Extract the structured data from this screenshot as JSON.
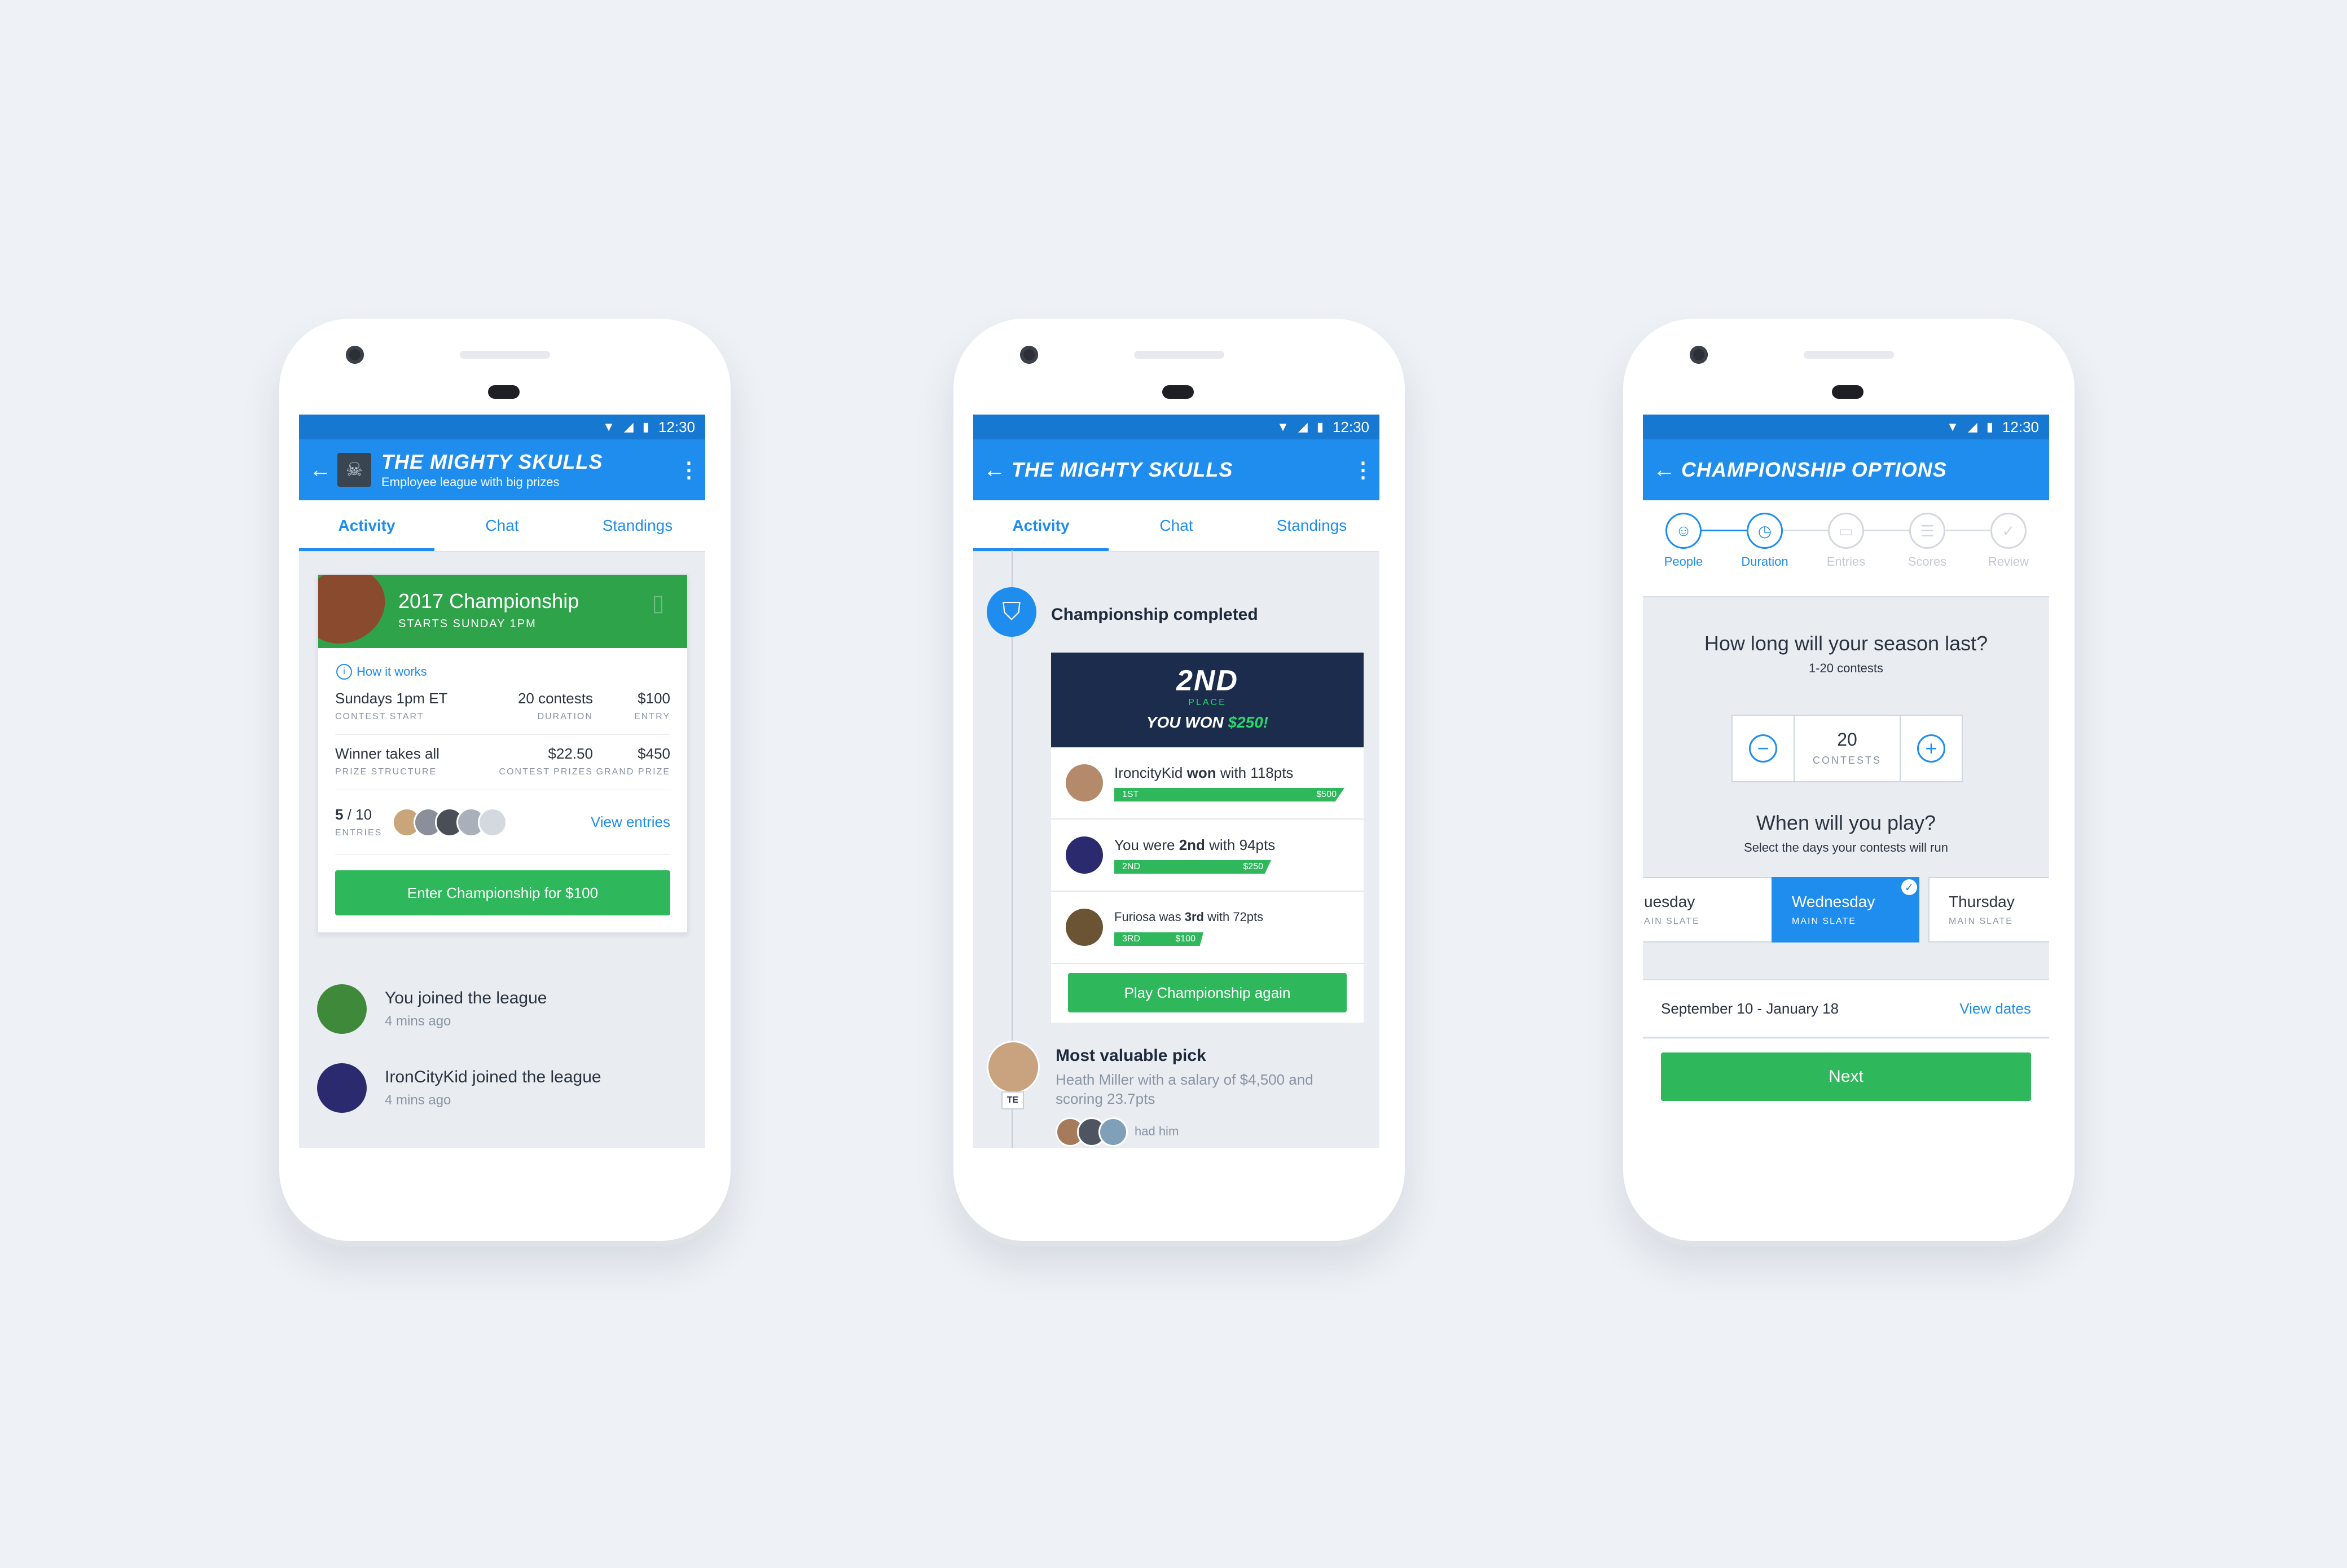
{
  "status": {
    "time": "12:30"
  },
  "screen1": {
    "title": "THE MIGHTY SKULLS",
    "subtitle": "Employee league with big prizes",
    "tabs": [
      "Activity",
      "Chat",
      "Standings"
    ],
    "card": {
      "title": "2017 Championship",
      "subtitle": "STARTS SUNDAY 1PM",
      "how": "How it works",
      "row1": [
        {
          "value": "Sundays 1pm ET",
          "label": "CONTEST START"
        },
        {
          "value": "20 contests",
          "label": "DURATION"
        },
        {
          "value": "$100",
          "label": "ENTRY"
        }
      ],
      "row2": [
        {
          "value": "Winner takes all",
          "label": "PRIZE STRUCTURE"
        },
        {
          "value": "$22.50",
          "label": "CONTEST PRIZES"
        },
        {
          "value": "$450",
          "label": "GRAND PRIZE"
        }
      ],
      "entries_count": "5",
      "entries_total": " / 10",
      "entries_label": "ENTRIES",
      "view_entries": "View entries",
      "enter_button": "Enter Championship for $100"
    },
    "feed": [
      {
        "text": "You joined the league",
        "time": "4 mins ago"
      },
      {
        "text": "IronCityKid joined the league",
        "time": "4 mins ago"
      }
    ]
  },
  "screen2": {
    "title": "THE MIGHTY SKULLS",
    "tabs": [
      "Activity",
      "Chat",
      "Standings"
    ],
    "completed": "Championship completed",
    "place": "2ND",
    "place_label": "PLACE",
    "won_prefix": "YOU WON ",
    "won_amount": "$250!",
    "results": [
      {
        "pre": "IroncityKid ",
        "bold": "won",
        "post": " with 118pts",
        "rank": "1ST",
        "amount": "$500"
      },
      {
        "pre": "You were ",
        "bold": "2nd",
        "post": " with 94pts",
        "rank": "2ND",
        "amount": "$250"
      },
      {
        "pre": "Furiosa was ",
        "bold": "3rd",
        "post": " with 72pts",
        "rank": "3RD",
        "amount": "$100"
      }
    ],
    "play_again": "Play Championship again",
    "mvp_title": "Most valuable pick",
    "mvp_desc": "Heath Miller with a salary of $4,500 and scoring 23.7pts",
    "mvp_pos": "TE",
    "had_him": "had him"
  },
  "screen3": {
    "title": "CHAMPIONSHIP OPTIONS",
    "steps": [
      "People",
      "Duration",
      "Entries",
      "Scores",
      "Review"
    ],
    "question1": "How long will your season last?",
    "question1_sub": "1-20 contests",
    "count": "20",
    "count_unit": "CONTESTS",
    "question2": "When will you play?",
    "question2_sub": "Select the days your contests will run",
    "days": [
      {
        "name": "uesday",
        "slate": "AIN SLATE"
      },
      {
        "name": "Wednesday",
        "slate": "MAIN SLATE"
      },
      {
        "name": "Thursday",
        "slate": "MAIN SLATE"
      }
    ],
    "date_range": "September 10 - January 18",
    "view_dates": "View dates",
    "next": "Next"
  },
  "colors": {
    "primary": "#1e8ded",
    "status_bar": "#1778d2",
    "green": "#2eb85b",
    "dark_navy": "#1c2c4c"
  }
}
